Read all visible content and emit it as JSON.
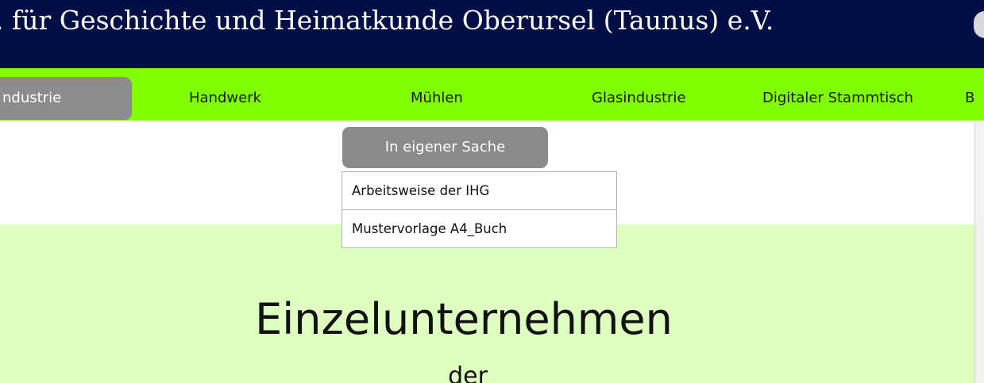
{
  "header": {
    "title": ". für Geschichte und Heimatkunde Oberursel (Taunus) e.V."
  },
  "nav": {
    "items": [
      {
        "label": "ndustrie",
        "active": true
      },
      {
        "label": "Handwerk"
      },
      {
        "label": "Mühlen"
      },
      {
        "label": "Glasindustrie"
      },
      {
        "label": "Digitaler Stammtisch"
      },
      {
        "label": "B"
      }
    ]
  },
  "submenu": {
    "title": "In eigener Sache",
    "items": [
      {
        "label": "Arbeitsweise der IHG"
      },
      {
        "label": "Mustervorlage A4_Buch"
      }
    ]
  },
  "content": {
    "title": "Einzelunternehmen",
    "subtitle": "der"
  },
  "colors": {
    "header_bg": "#000f45",
    "nav_bg": "#80ff00",
    "active_tab_bg": "#8c8c8c",
    "content_bg": "#ddffc0"
  }
}
